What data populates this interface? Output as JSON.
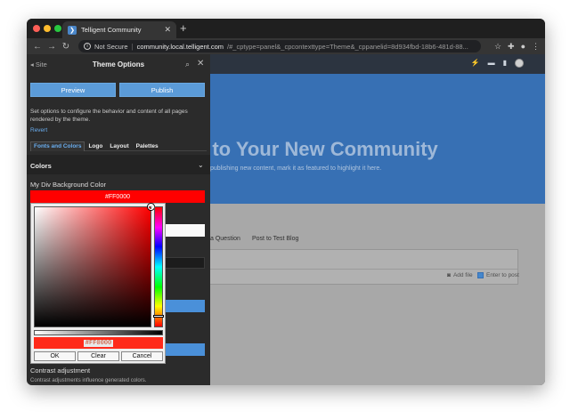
{
  "browser": {
    "tab_title": "Telligent Community",
    "tab_favicon": "telligent-logo-icon",
    "new_tab_label": "+",
    "not_secure": "Not Secure",
    "url_host": "community.local.telligent.com",
    "url_rest": "/#_cptype=panel&_cpcontexttype=Theme&_cppanelid=8d934fbd-18b6-481d-88...",
    "traffic_lights": [
      "#ff5f57",
      "#febc2e",
      "#28c840"
    ]
  },
  "site": {
    "banner_title": "e to Your New Community",
    "banner_sub": "publishing new content, mark it as featured to highlight it here.",
    "page_tabs": [
      "a Question",
      "Post to Test Blog"
    ],
    "add_file": "Add file",
    "enter_to_post": "Enter to post"
  },
  "panel": {
    "back_label": "◂ Site",
    "title": "Theme Options",
    "preview_label": "Preview",
    "publish_label": "Publish",
    "description": "Set options to configure the behavior and content of all pages rendered by the theme.",
    "revert_label": "Revert",
    "tabs": [
      "Fonts and Colors",
      "Logo",
      "Layout",
      "Palettes"
    ],
    "section_title": "Colors",
    "field_label": "My Div Background Color",
    "field_value": "#FF0000",
    "contrast_title": "Contrast adjustment",
    "contrast_desc": "Contrast adjustments influence generated colors."
  },
  "picker": {
    "hex_value": "#FF0000",
    "ok_label": "OK",
    "clear_label": "Clear",
    "cancel_label": "Cancel"
  },
  "colors": {
    "accent": "#5b9bd8",
    "selected_color": "#ff0000",
    "banner": "#3b78c0"
  }
}
